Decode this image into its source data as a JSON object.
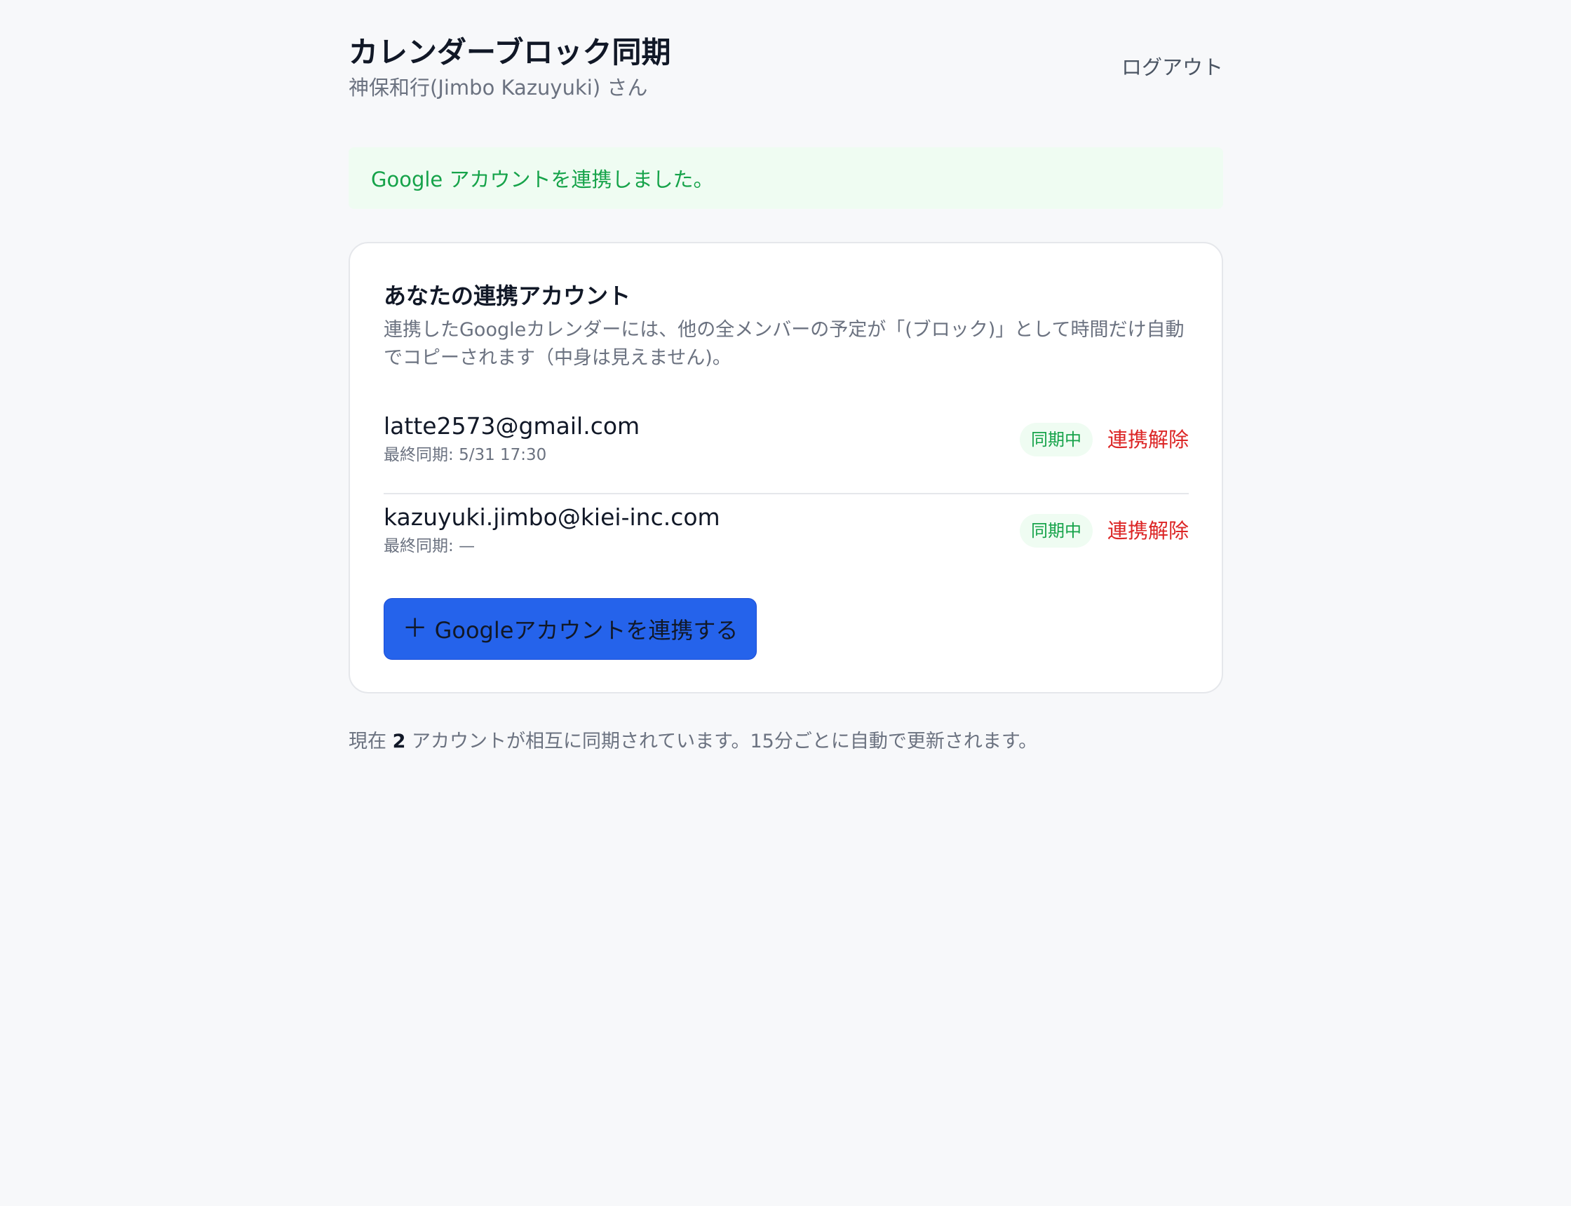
{
  "header": {
    "title": "カレンダーブロック同期",
    "user": "神保和行(Jimbo Kazuyuki) さん",
    "logout_label": "ログアウト"
  },
  "notice": {
    "message": "Google アカウントを連携しました。",
    "color": "#16a34a"
  },
  "card": {
    "title": "あなたの連携アカウント",
    "description": "連携したGoogleカレンダーには、他の全メンバーの予定が「(ブロック)」として時間だけ自動でコピーされます（中身は見えません)。",
    "accounts": [
      {
        "email": "latte2573@gmail.com",
        "last_sync_label": "最終同期: ",
        "last_sync_value": "5/31 17:30",
        "status": "同期中",
        "unlink_label": "連携解除"
      },
      {
        "email": "kazuyuki.jimbo@kiei-inc.com",
        "last_sync_label": "最終同期: ",
        "last_sync_value": "—",
        "status": "同期中",
        "unlink_label": "連携解除"
      }
    ],
    "add_button": {
      "icon": "plus-icon",
      "label": "Googleアカウントを連携する",
      "color": "#2563eb"
    }
  },
  "footer": {
    "prefix": "現在 ",
    "count": "2",
    "suffix": " アカウントが相互に同期されています。15分ごとに自動で更新されます。"
  },
  "colors": {
    "background": "#f7f8fa",
    "accent": "#2563eb",
    "success": "#16a34a",
    "danger": "#dc2626"
  }
}
